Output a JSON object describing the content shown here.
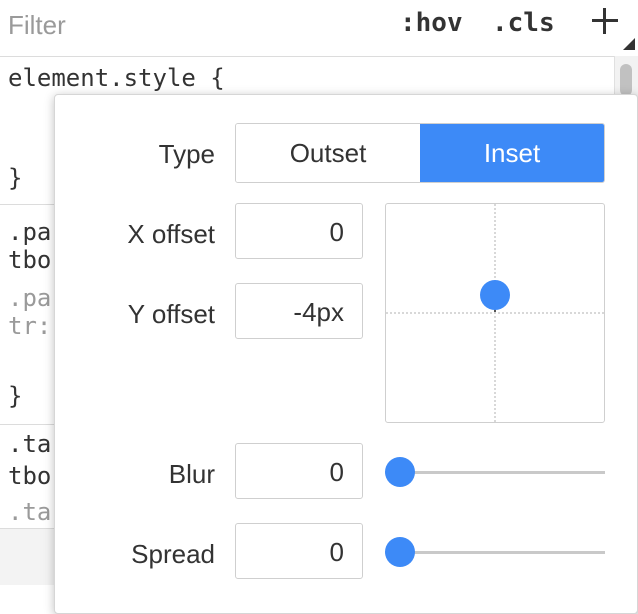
{
  "toolbar": {
    "filter_placeholder": "Filter",
    "hov_label": ":hov",
    "cls_label": ".cls"
  },
  "styles": {
    "element_style_selector": "element.style {",
    "close_brace_1": "}",
    "rule2_line1": ".pa",
    "rule2_line2": "tbo",
    "rule2_line3": ".pa",
    "rule2_line4": "tr:",
    "close_brace_2": "}",
    "rule3_line1": ".ta",
    "rule3_line2": "tbo",
    "rule3_line3": ".ta"
  },
  "shadow_editor": {
    "type_label": "Type",
    "type_options": [
      "Outset",
      "Inset"
    ],
    "type_selected": "Inset",
    "x_offset_label": "X offset",
    "x_offset_value": "0",
    "y_offset_label": "Y offset",
    "y_offset_value": "-4px",
    "blur_label": "Blur",
    "blur_value": "0",
    "spread_label": "Spread",
    "spread_value": "0",
    "accent_color": "#3d8af7"
  }
}
